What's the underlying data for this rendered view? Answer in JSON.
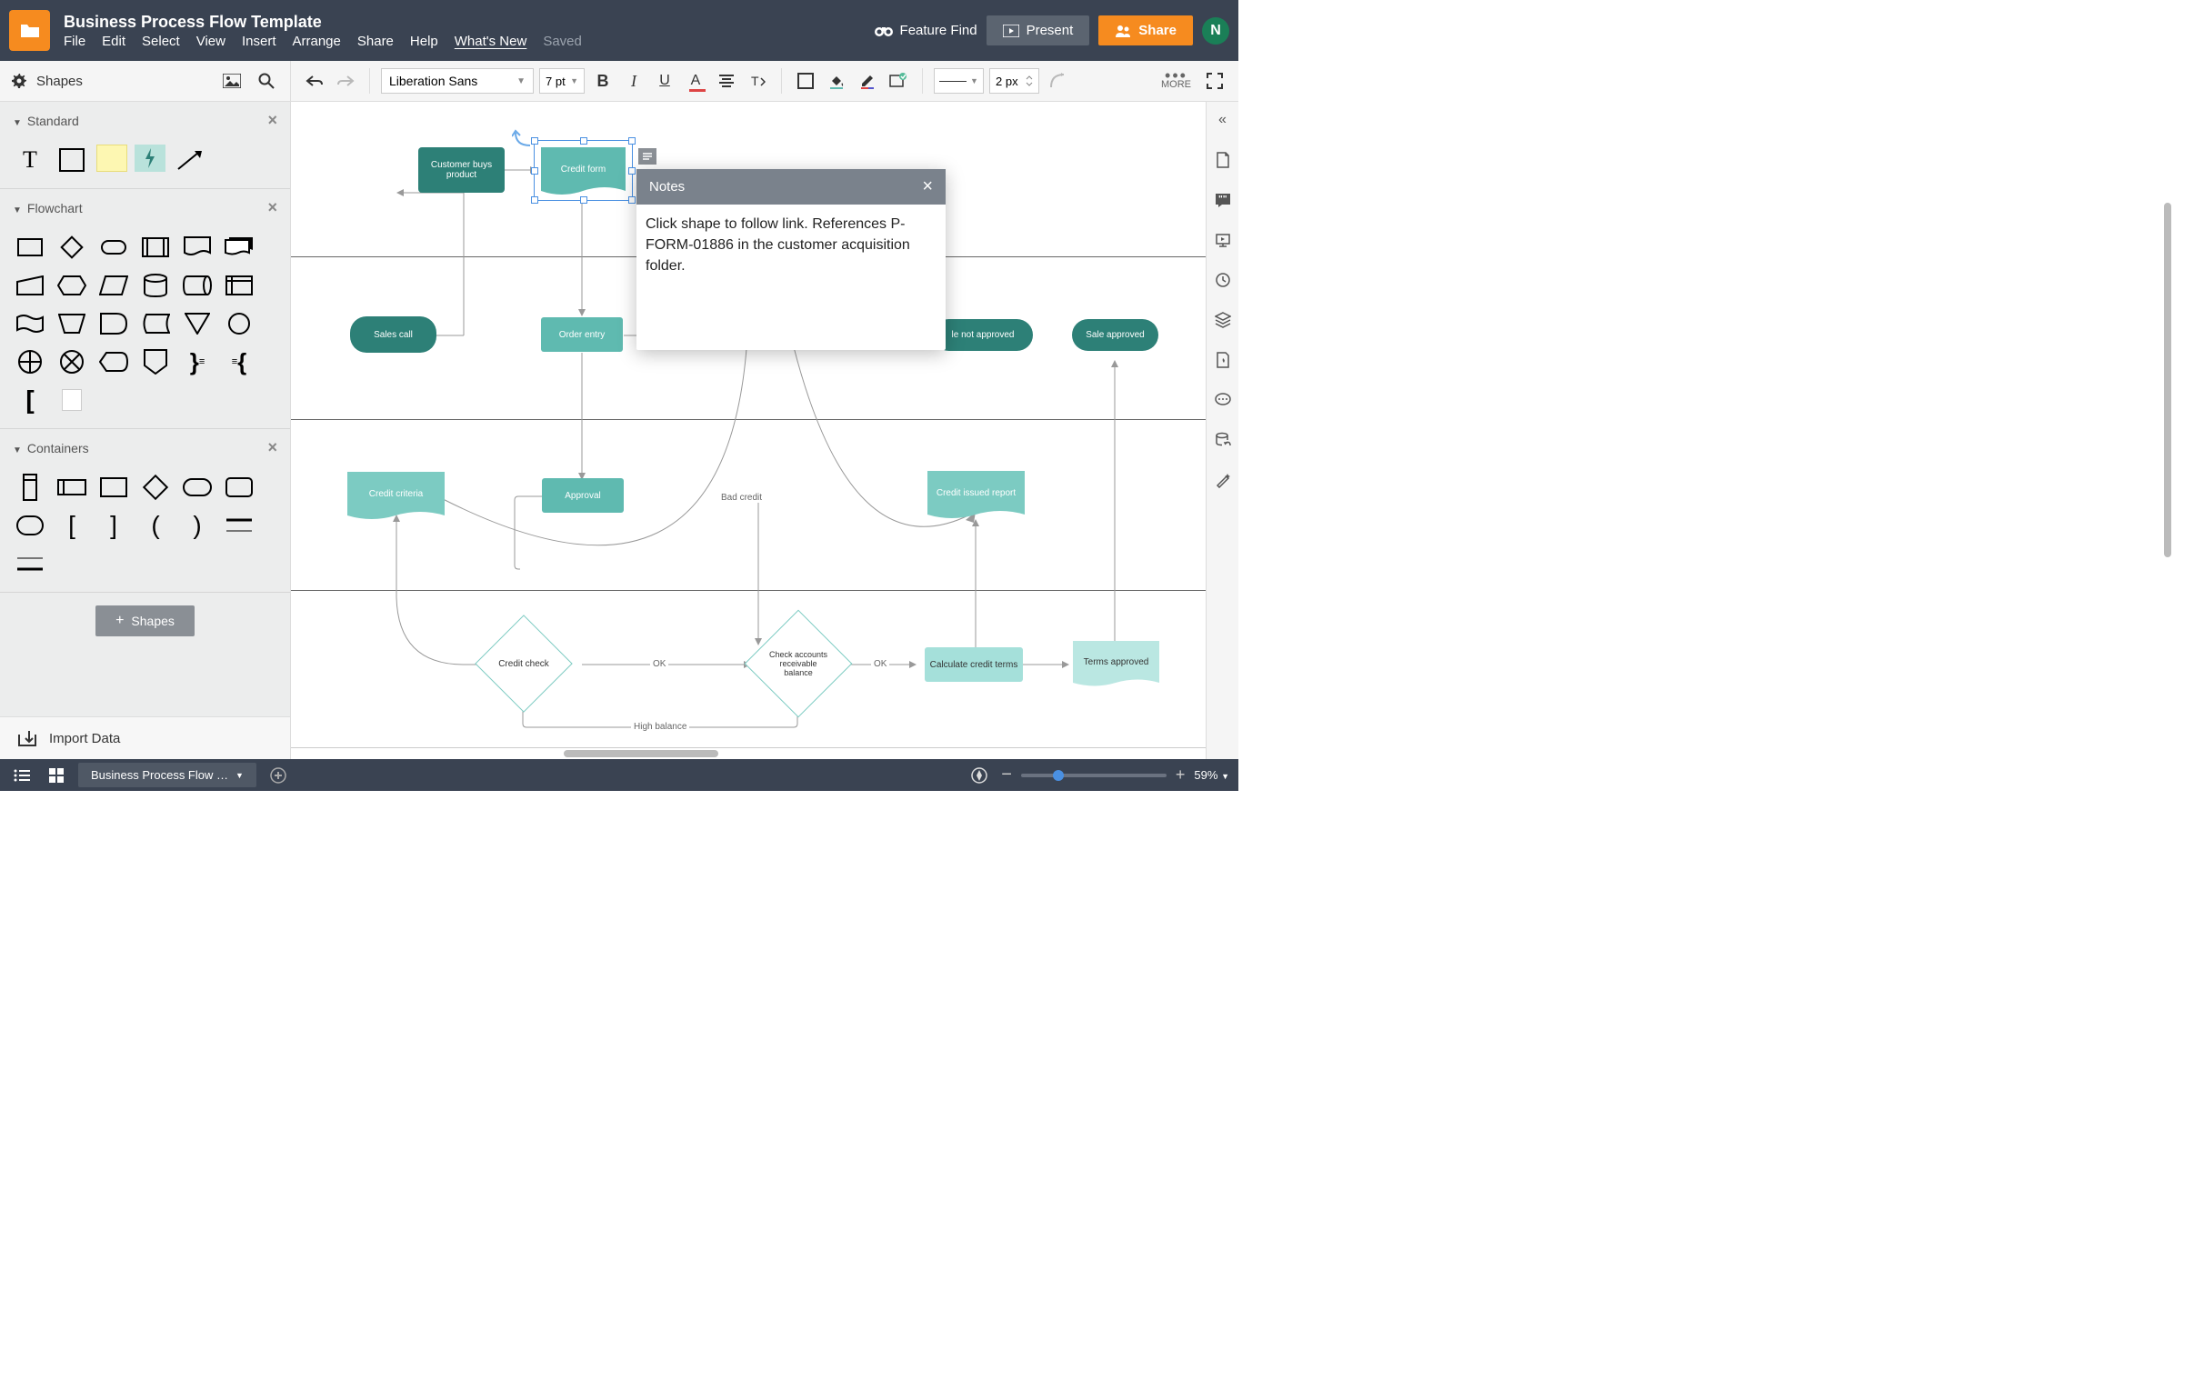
{
  "header": {
    "title": "Business Process Flow Template",
    "menus": [
      "File",
      "Edit",
      "Select",
      "View",
      "Insert",
      "Arrange",
      "Share",
      "Help"
    ],
    "whats_new": "What's New",
    "saved": "Saved",
    "feature_find": "Feature Find",
    "present": "Present",
    "share": "Share",
    "avatar_initial": "N"
  },
  "toolbar": {
    "shapes_label": "Shapes",
    "font": "Liberation Sans",
    "font_size": "7 pt",
    "line_width": "2 px",
    "more": "MORE"
  },
  "sidebar": {
    "section_standard": "Standard",
    "section_flowchart": "Flowchart",
    "section_containers": "Containers",
    "shapes_btn": "Shapes",
    "import_data": "Import Data"
  },
  "canvas": {
    "nodes": {
      "sales_call": "Sales call",
      "customer_buys": "Customer buys product",
      "credit_form": "Credit form",
      "order_entry": "Order entry",
      "sale_not_approved": "le not approved",
      "sale_approved": "Sale approved",
      "credit_criteria": "Credit criteria",
      "approval": "Approval",
      "credit_issued": "Credit issued report",
      "credit_check": "Credit check",
      "check_accounts": "Check accounts receivable balance",
      "calculate_terms": "Calculate credit terms",
      "terms_approved": "Terms approved"
    },
    "edge_labels": {
      "bad_credit": "Bad credit",
      "ok1": "OK",
      "ok2": "OK",
      "high_balance": "High balance"
    }
  },
  "notes": {
    "title": "Notes",
    "body": "Click shape to follow link. References P-FORM-01886 in the customer acquisition folder."
  },
  "footer": {
    "tab_name": "Business Process Flow …",
    "zoom": "59%"
  }
}
